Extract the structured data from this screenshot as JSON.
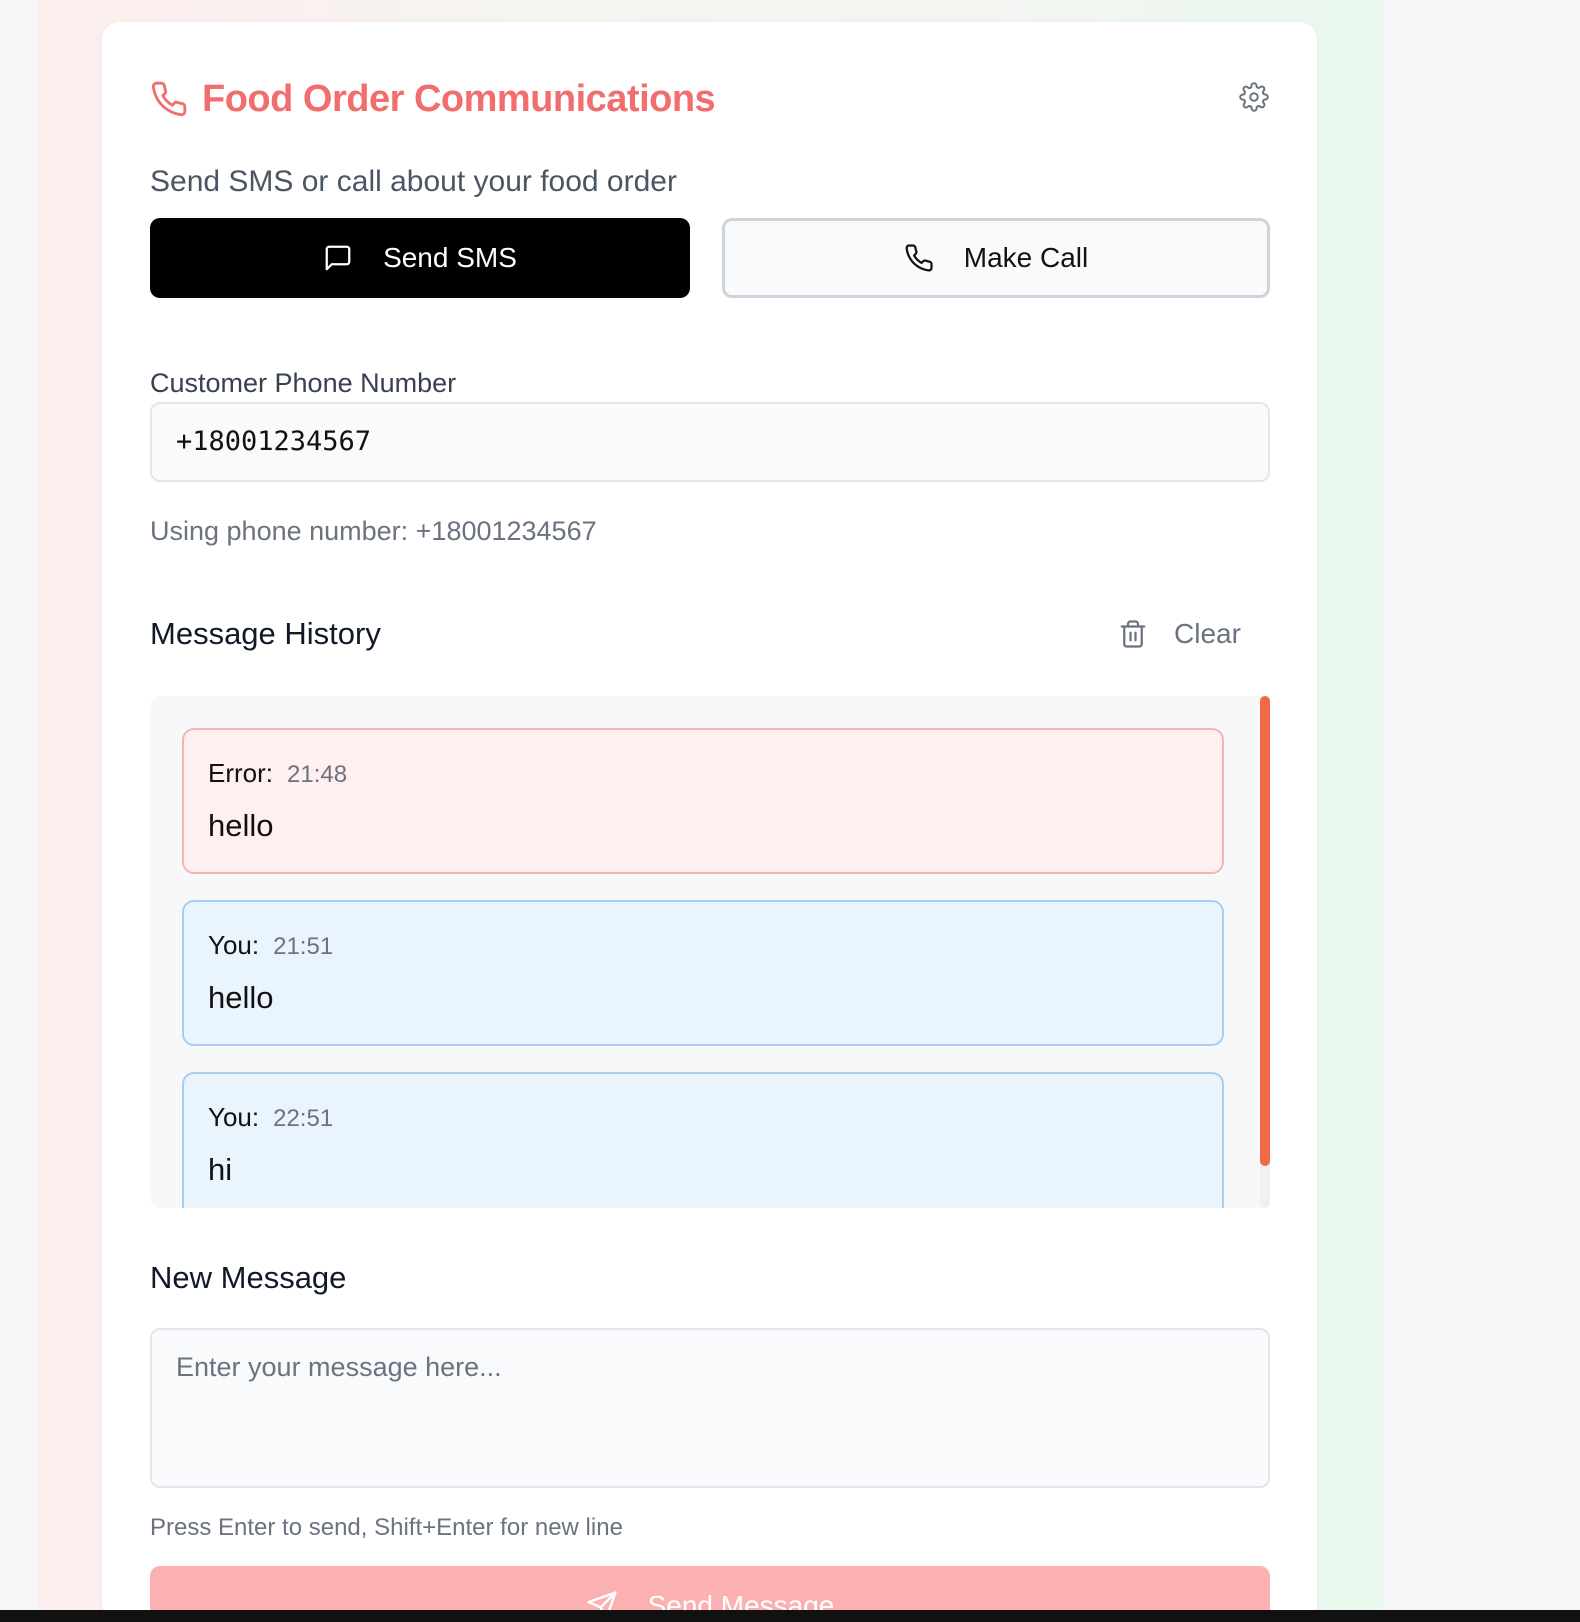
{
  "header": {
    "title": "Food Order Communications",
    "subtitle": "Send SMS or call about your food order",
    "title_color": "#f26d6d"
  },
  "mode_buttons": {
    "sms_label": "Send SMS",
    "call_label": "Make Call",
    "active": "sms"
  },
  "phone": {
    "label": "Customer Phone Number",
    "value": "+18001234567",
    "using_text": "Using phone number: +18001234567"
  },
  "history": {
    "title": "Message History",
    "clear_label": "Clear",
    "messages": [
      {
        "sender": "Error:",
        "time": "21:48",
        "text": "hello",
        "kind": "error"
      },
      {
        "sender": "You:",
        "time": "21:51",
        "text": "hello",
        "kind": "you"
      },
      {
        "sender": "You:",
        "time": "22:51",
        "text": "hi",
        "kind": "you"
      }
    ]
  },
  "composer": {
    "title": "New Message",
    "placeholder": "Enter your message here...",
    "hint": "Press Enter to send, Shift+Enter for new line",
    "send_label": "Send Message"
  },
  "colors": {
    "accent": "#f26d6d",
    "scrollbar_thumb": "#f26a45",
    "send_button_disabled": "#fbb1b1"
  }
}
